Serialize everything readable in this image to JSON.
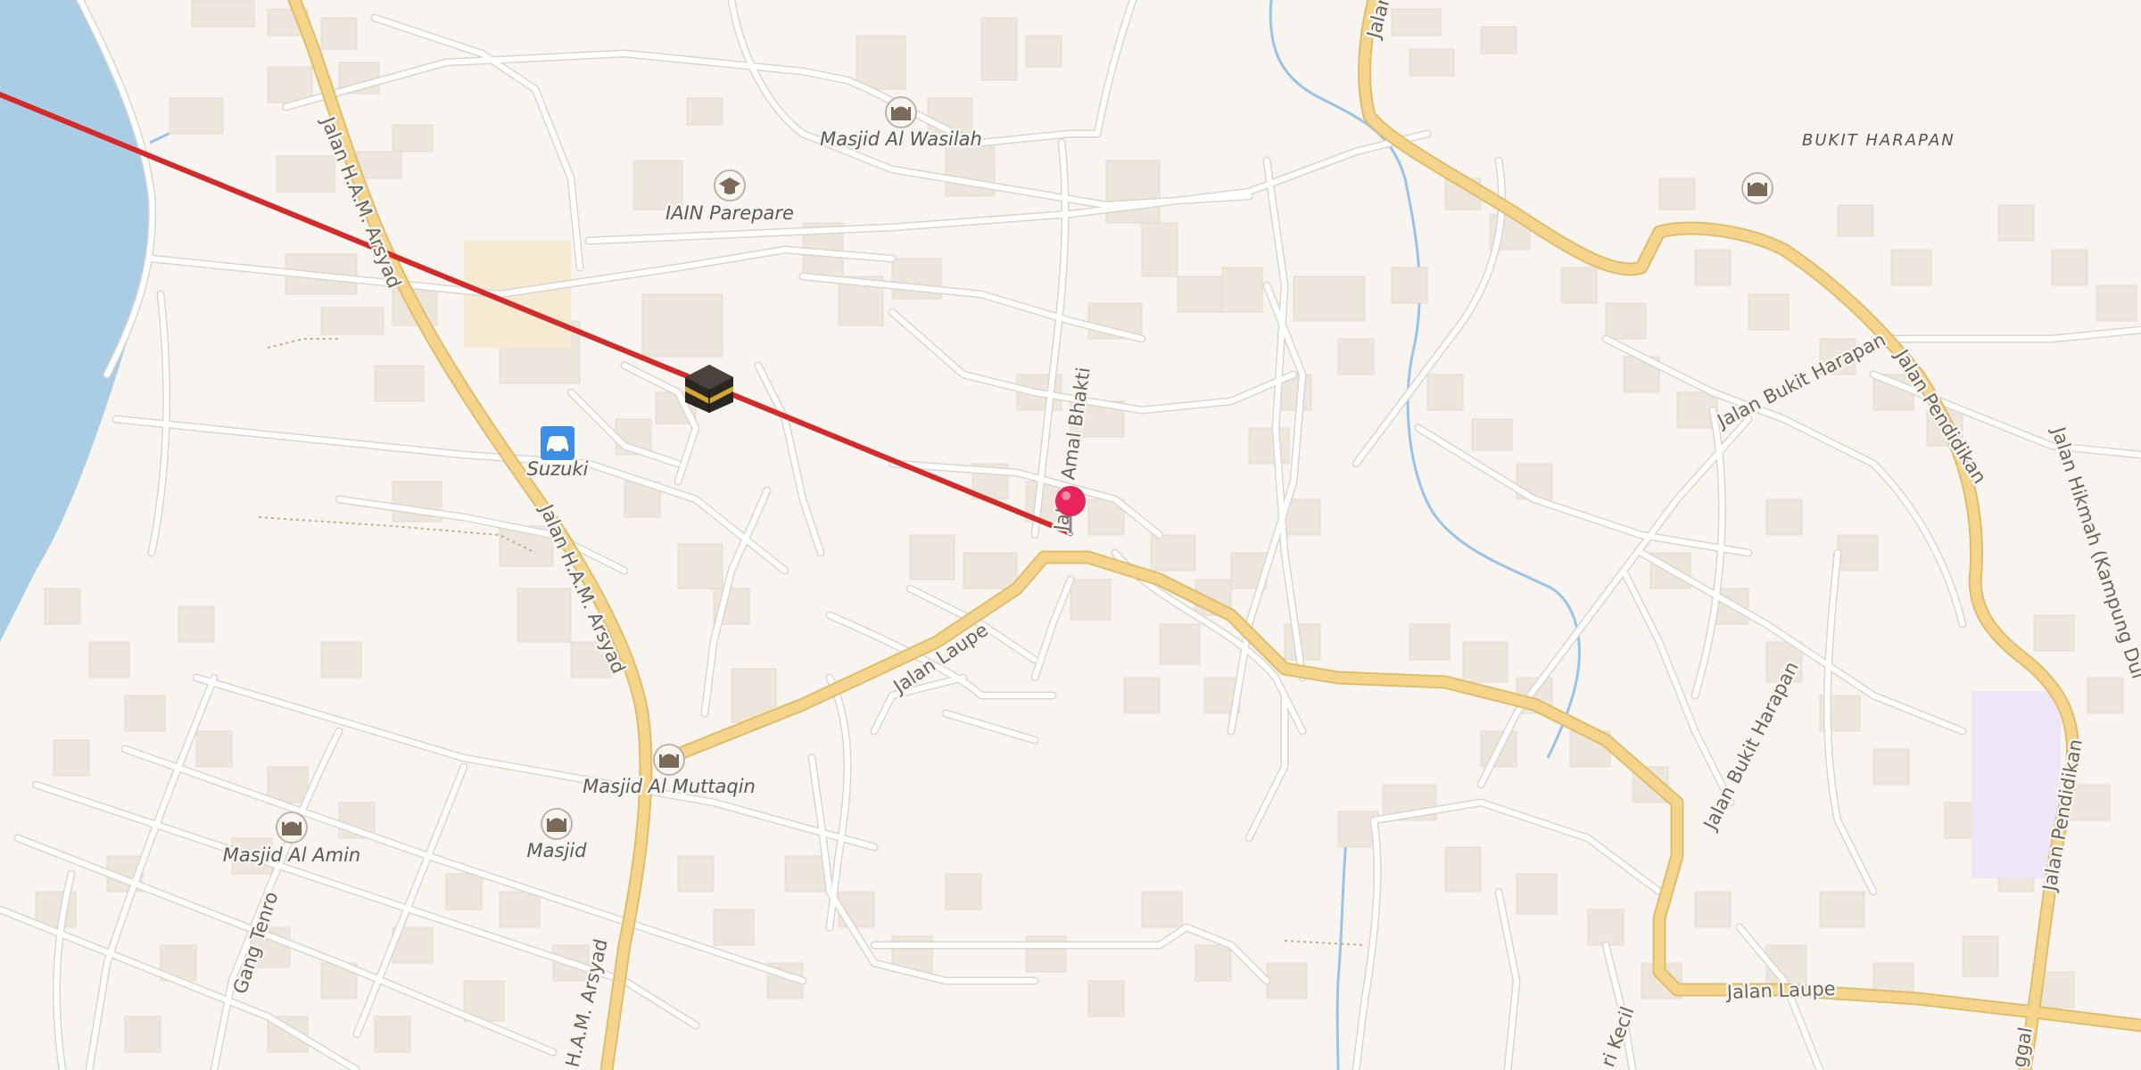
{
  "map": {
    "area_labels": {
      "bukit_harapan": "BUKIT HARAPAN"
    },
    "pois": {
      "masjid_al_wasilah": "Masjid Al Wasilah",
      "iain_parepare": "IAIN Parepare",
      "suzuki": "Suzuki",
      "masjid_al_muttaqin": "Masjid Al Muttaqin",
      "masjid_al_amin": "Masjid Al Amin",
      "masjid": "Masjid"
    },
    "roads": {
      "ham_arsyad_top": "Jalan H.A.M. Arsyad",
      "ham_arsyad_mid": "Jalan H.A.M. Arsyad",
      "ham_arsyad_bottom": "H.A.M. Arsyad",
      "jalan_laupe_left": "Jalan Laupe",
      "jalan_laupe_right": "Jalan Laupe",
      "jalan_amal_bhakti": "Jalan Amal Bhakti",
      "jalan_bukit_harapan_1": "Jalan Bukit Harapan",
      "jalan_bukit_harapan_2": "Jalan Bukit Harapan",
      "jalan_pendidikan_1": "Jalan Pendidikan",
      "jalan_pendidikan_2": "Jalan Pendidikan",
      "jalan_hikmah": "Jalan Hikmah (Kampung Dui",
      "gang_tenro": "Gang Tenro",
      "jalan_top": "Jalan",
      "partial_bottom_1": "ri Kecil",
      "partial_bottom_2": "ggal"
    },
    "colors": {
      "land": "#f8f5f1",
      "water": "#a9cde4",
      "major_road": "#f5d48c",
      "major_road_casing": "#e0bd6d",
      "minor_road": "#ffffff",
      "building": "#ece6dd",
      "qibla_line": "#d42a2a",
      "pin": "#e8245c"
    },
    "icons": [
      "mosque-icon",
      "university-icon",
      "car-icon",
      "kaaba-icon",
      "location-pin-icon"
    ]
  }
}
